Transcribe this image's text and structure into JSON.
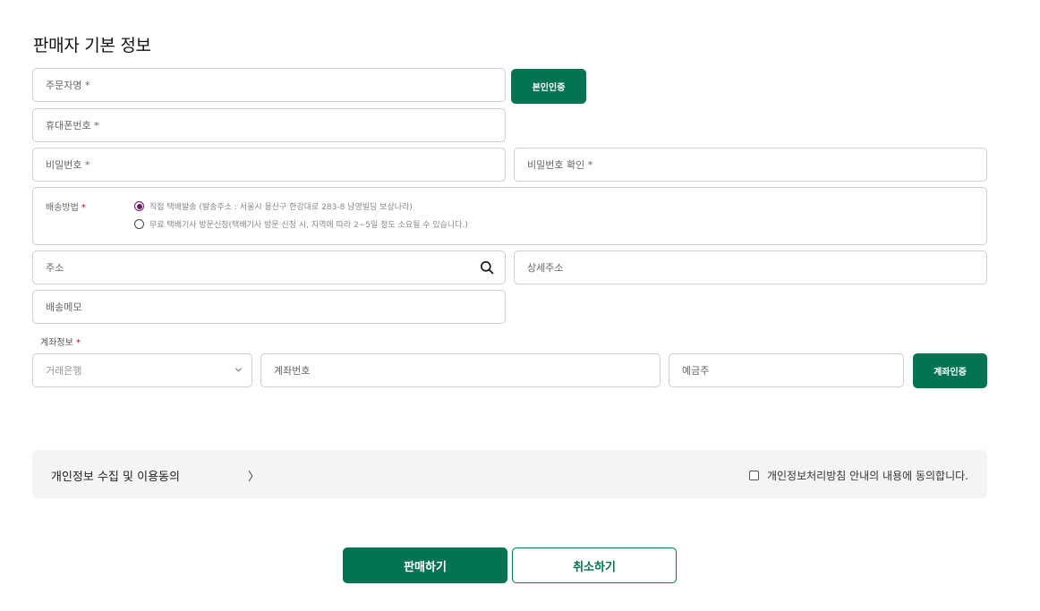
{
  "page_title": "판매자 기본 정보",
  "fields": {
    "orderer_name": "주문자명 *",
    "verify_button": "본인인증",
    "phone": "휴대폰번호 *",
    "password": "비밀번호 *",
    "password_confirm": "비밀번호 확인 *",
    "address": "주소",
    "address_detail": "상세주소",
    "delivery_memo": "배송메모"
  },
  "delivery": {
    "label": "배송방법",
    "required_mark": "*",
    "options": [
      {
        "label": "직접 택배발송 (발송주소 : 서울시 용산구 한강대로 283-8 남영빌딩 보상나라)",
        "checked": true
      },
      {
        "label": "무료 택배기사 방문신청(택배기사 방문 신청 시, 지역에 따라 2~5일 정도 소요될 수 있습니다.)",
        "checked": false
      }
    ]
  },
  "account": {
    "label": "계좌정보",
    "required_mark": "*",
    "bank_placeholder": "거래은행",
    "account_number": "계좌번호",
    "holder": "예금주",
    "verify_button": "계좌인증"
  },
  "consent": {
    "title": "개인정보 수집 및 이용동의",
    "chevron": "〉",
    "agree_text": "개인정보처리방침 안내의 내용에 동의합니다."
  },
  "actions": {
    "submit": "판매하기",
    "cancel": "취소하기"
  },
  "colors": {
    "brand_green": "#047351",
    "radio_checked": "#6b1a6b",
    "required_red": "#d0021b"
  }
}
